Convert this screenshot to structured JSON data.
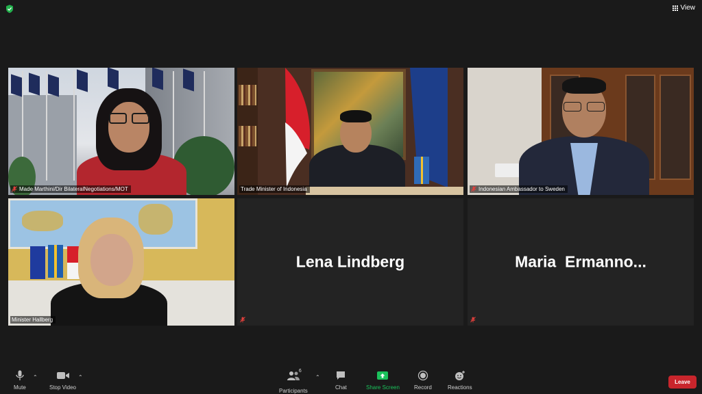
{
  "topbar": {
    "view_label": "View"
  },
  "tiles": [
    {
      "name": "Made Marthini/Dir BilateralNegotiations/MOT"
    },
    {
      "name": "Trade Minister of Indonesia"
    },
    {
      "name": "Indonesian Ambassador to Sweden"
    },
    {
      "name": "Minister Hallberg"
    },
    {
      "name": "Lena Lindberg"
    },
    {
      "name": "Maria  Ermanno..."
    }
  ],
  "toolbar": {
    "mute_label": "Mute",
    "stop_video_label": "Stop Video",
    "participants_label": "Participants",
    "participants_count": "6",
    "chat_label": "Chat",
    "share_screen_label": "Share Screen",
    "record_label": "Record",
    "reactions_label": "Reactions",
    "leave_label": "Leave"
  },
  "icons": [
    "shield-icon",
    "grid-icon",
    "mic-muted-icon",
    "mic-icon",
    "video-icon",
    "participants-icon",
    "chat-icon",
    "share-screen-icon",
    "record-icon",
    "reactions-icon",
    "caret-up-icon"
  ],
  "colors": {
    "background": "#1a1a1a",
    "active_speaker_border": "#c5e24b",
    "share_screen_green": "#1bc15b",
    "leave_red": "#c8252c",
    "muted_red": "#e0403c"
  }
}
